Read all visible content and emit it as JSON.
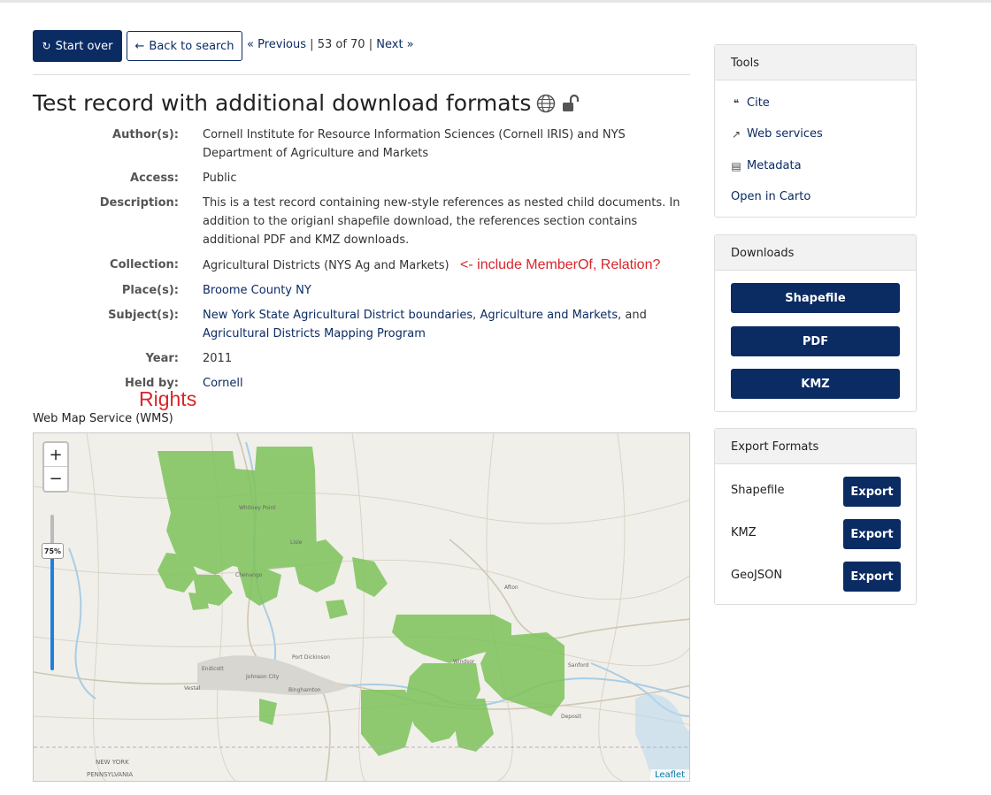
{
  "nav": {
    "start_over": "Start over",
    "back_to_search": "Back to search",
    "previous": "« Previous",
    "position": "53 of 70",
    "next": "Next »",
    "sep": "|"
  },
  "title": "Test record with additional download formats",
  "metadata": {
    "author_label": "Author(s):",
    "author_value": "Cornell Institute for Resource Information Sciences (Cornell IRIS) and NYS Department of Agriculture and Markets",
    "access_label": "Access:",
    "access_value": "Public",
    "description_label": "Description:",
    "description_value": "This is a test record containing new-style references as nested child documents. In addition to the origianl shapefile download, the references section contains additional PDF and KMZ downloads.",
    "collection_label": "Collection:",
    "collection_value": "Agricultural Districts (NYS Ag and Markets)",
    "collection_annotation": "<- include MemberOf, Relation?",
    "place_label": "Place(s):",
    "place_value": "Broome County NY",
    "subject_label": "Subject(s):",
    "subject_1": "New York State Agricultural District boundaries",
    "subject_2": "Agriculture and Markets",
    "subject_3": "Agricultural Districts Mapping Program",
    "subject_sep": ",",
    "subject_and": ", and",
    "year_label": "Year:",
    "year_value": "2011",
    "held_label": "Held by:",
    "held_value": "Cornell"
  },
  "rights_annotation": "Rights",
  "wms_label": "Web Map Service (WMS)",
  "map": {
    "zoom_in": "+",
    "zoom_out": "−",
    "opacity": "75%",
    "attribution": "Leaflet",
    "place_labels": [
      "Binghamton",
      "Port Dickinson",
      "Vestal",
      "Johnson City",
      "Endicott",
      "Chenango",
      "Whitney Point",
      "Windsor",
      "Deposit",
      "Lisle",
      "NEW YORK",
      "PENNSYLVANIA",
      "Afton",
      "Sanford"
    ]
  },
  "tools": {
    "header": "Tools",
    "items": [
      {
        "icon": "quote-icon",
        "label": "Cite"
      },
      {
        "icon": "external-link-icon",
        "label": "Web services"
      },
      {
        "icon": "document-icon",
        "label": "Metadata"
      },
      {
        "icon": "",
        "label": "Open in Carto"
      }
    ]
  },
  "downloads": {
    "header": "Downloads",
    "items": [
      "Shapefile",
      "PDF",
      "KMZ"
    ]
  },
  "exports": {
    "header": "Export Formats",
    "button_label": "Export",
    "items": [
      "Shapefile",
      "KMZ",
      "GeoJSON"
    ]
  },
  "colors": {
    "primary": "#0b2b63",
    "annotation": "#d8262b",
    "polygon": "#7dc35b"
  }
}
